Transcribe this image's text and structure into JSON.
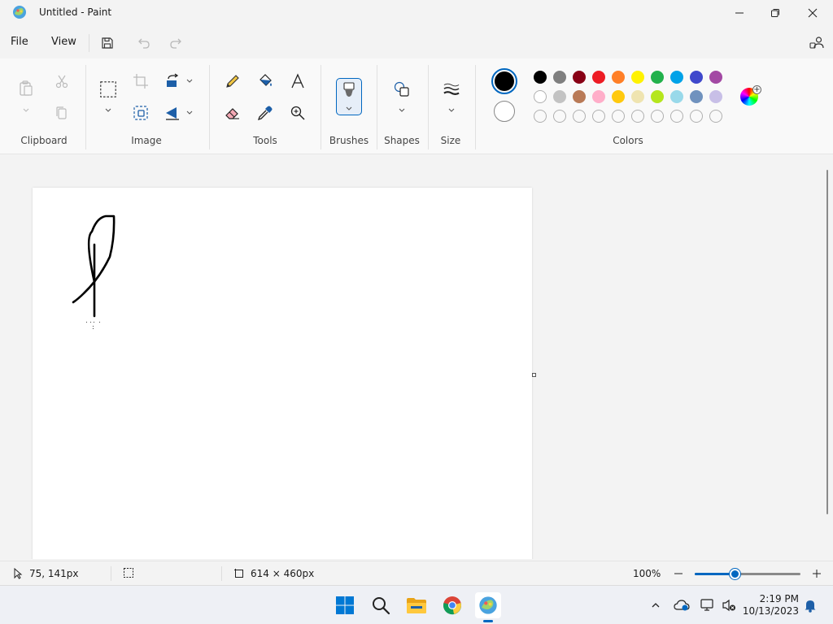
{
  "window": {
    "title": "Untitled - Paint"
  },
  "menu": {
    "file": "File",
    "view": "View"
  },
  "ribbon": {
    "groups": {
      "clipboard": "Clipboard",
      "image": "Image",
      "tools": "Tools",
      "brushes": "Brushes",
      "shapes": "Shapes",
      "size": "Size",
      "colors": "Colors"
    },
    "palette_row1": [
      "#000000",
      "#7f7f7f",
      "#880015",
      "#ed1c24",
      "#ff7f27",
      "#fff200",
      "#22b14c",
      "#00a2e8",
      "#3f48cc",
      "#a349a4"
    ],
    "palette_row2": [
      "#ffffff",
      "#c3c3c3",
      "#b97a57",
      "#ffaec9",
      "#ffc90e",
      "#efe4b0",
      "#b5e61d",
      "#99d9ea",
      "#7092be",
      "#c8bfe7"
    ],
    "primary_color": "#000000",
    "secondary_color": "#ffffff"
  },
  "status": {
    "cursor_pos": "75, 141px",
    "canvas_size": "614 × 460px",
    "zoom": "100%",
    "zoom_fraction": 0.38
  },
  "taskbar": {
    "time": "2:19 PM",
    "date": "10/13/2023"
  },
  "accent": "#0067c0"
}
